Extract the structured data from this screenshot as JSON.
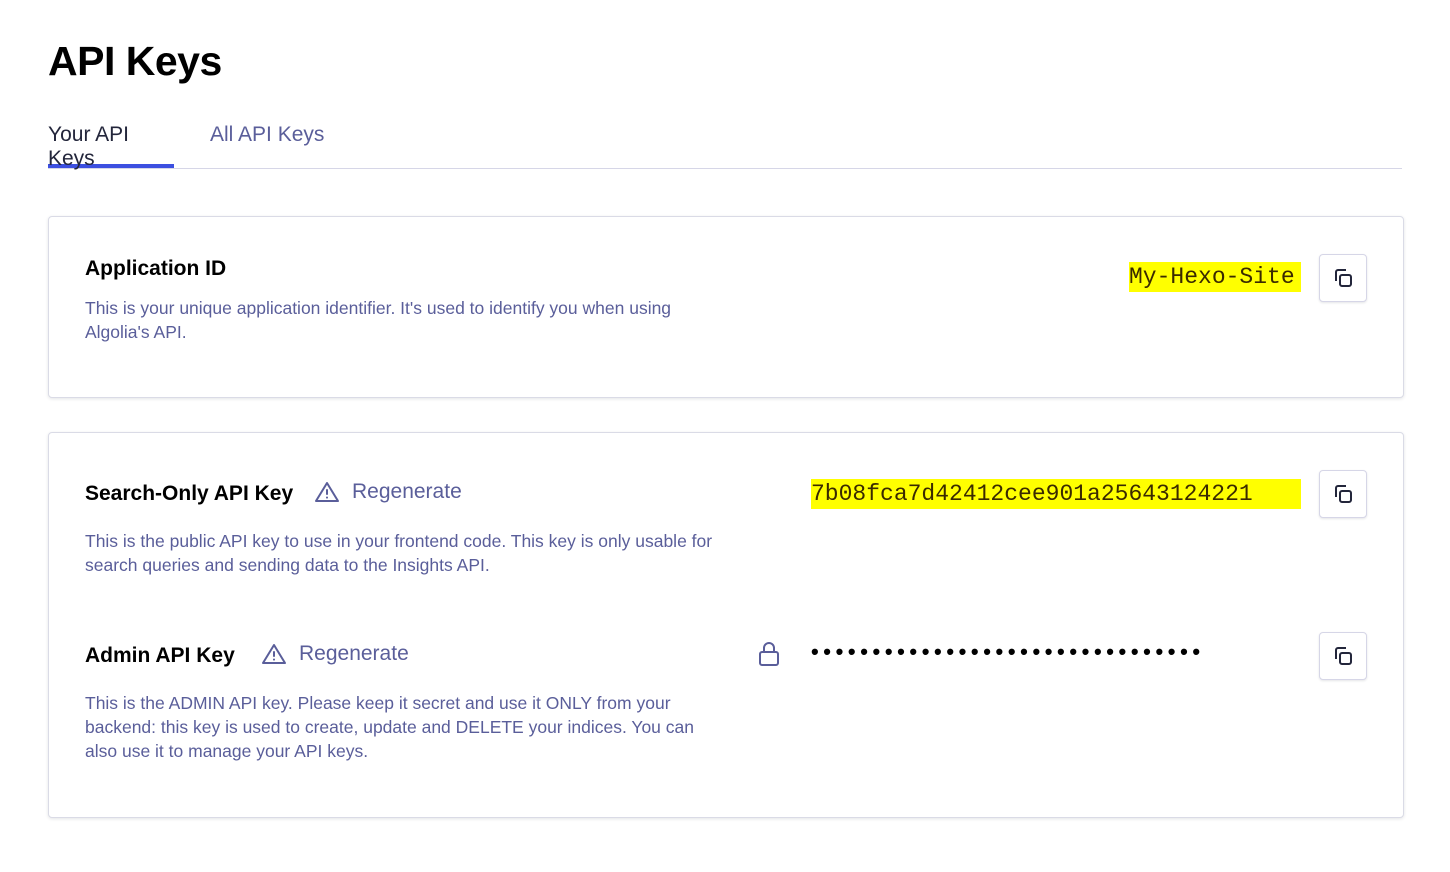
{
  "page": {
    "title": "API Keys"
  },
  "tabs": [
    {
      "label": "Your API Keys",
      "active": true
    },
    {
      "label": "All API Keys",
      "active": false
    }
  ],
  "application_id": {
    "title": "Application ID",
    "description": "This is your unique application identifier. It's used to identify you when using Algolia's API.",
    "value": "My-Hexo-Site",
    "copy_icon": "copy-icon"
  },
  "search_key": {
    "title": "Search-Only API Key",
    "regenerate_label": "Regenerate",
    "warning_icon": "warning-icon",
    "description": "This is the public API key to use in your frontend code. This key is only usable for search queries and sending data to the Insights API.",
    "value": "7b08fca7d42412cee901a25643124221",
    "copy_icon": "copy-icon"
  },
  "admin_key": {
    "title": "Admin API Key",
    "regenerate_label": "Regenerate",
    "warning_icon": "warning-icon",
    "lock_icon": "lock-icon",
    "description": "This is the ADMIN API key. Please keep it secret and use it ONLY from your backend: this key is used to create, update and DELETE your indices. You can also use it to manage your API keys.",
    "masked_value": "••••••••••••••••••••••••••••••••",
    "copy_icon": "copy-icon"
  },
  "colors": {
    "accent": "#3c4fe0",
    "muted_text": "#5a5e9a",
    "highlight": "#ffff00",
    "border": "#dadbe6"
  }
}
